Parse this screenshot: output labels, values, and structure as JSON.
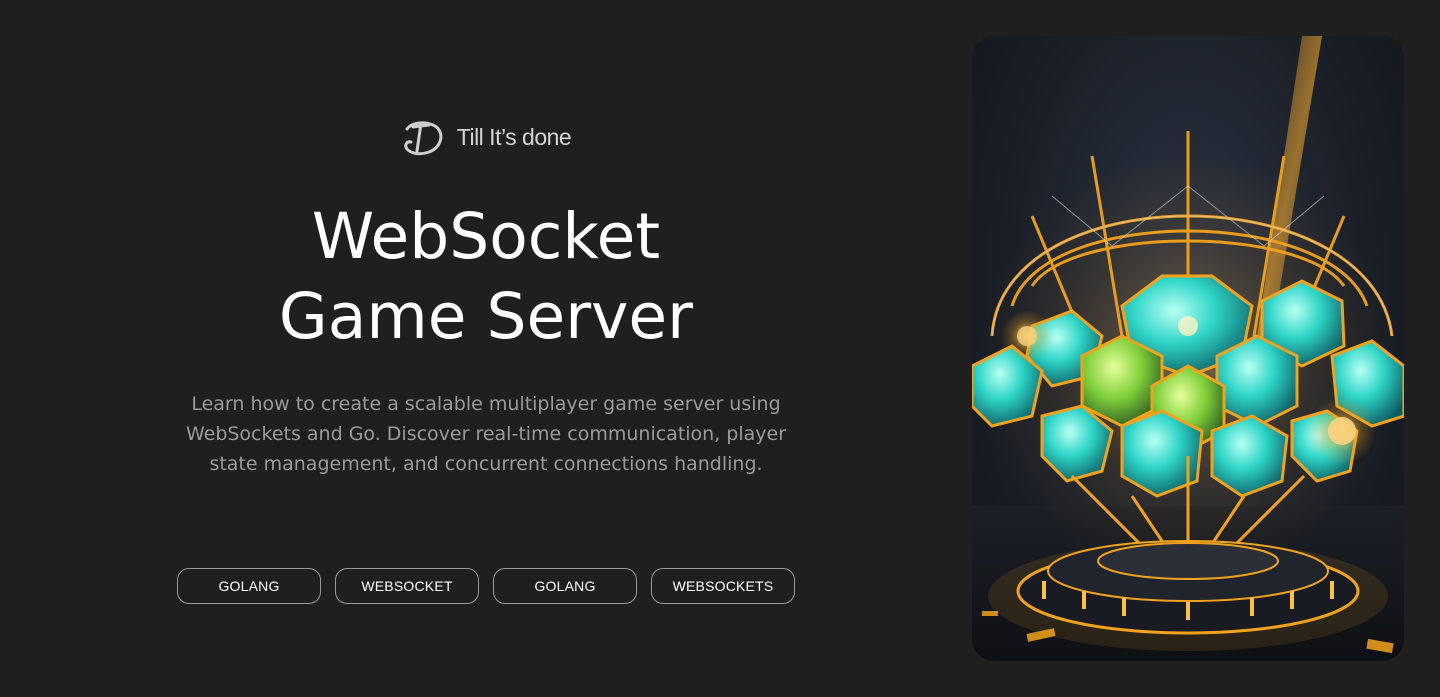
{
  "brand": {
    "logo_icon": "td-monogram-logo",
    "name": "Till It’s done"
  },
  "hero": {
    "title_line1": "WebSocket",
    "title_line2": "Game Server",
    "description": "Learn how to create a scalable multiplayer game server using WebSockets and Go. Discover real-time communication, player state management, and concurrent connections handling."
  },
  "tags": [
    {
      "label": "GOLANG"
    },
    {
      "label": "WEBSOCKET"
    },
    {
      "label": "GOLANG"
    },
    {
      "label": "WEBSOCKETS"
    }
  ],
  "image": {
    "subject": "glowing-crystal-dome-illustration"
  },
  "colors": {
    "background": "#1f1f1f",
    "text_primary": "#ffffff",
    "text_muted": "#9b9b9b",
    "tag_border": "#9a9a9a",
    "accent_gold": "#f2a31b",
    "accent_cyan": "#2fd6c8"
  }
}
